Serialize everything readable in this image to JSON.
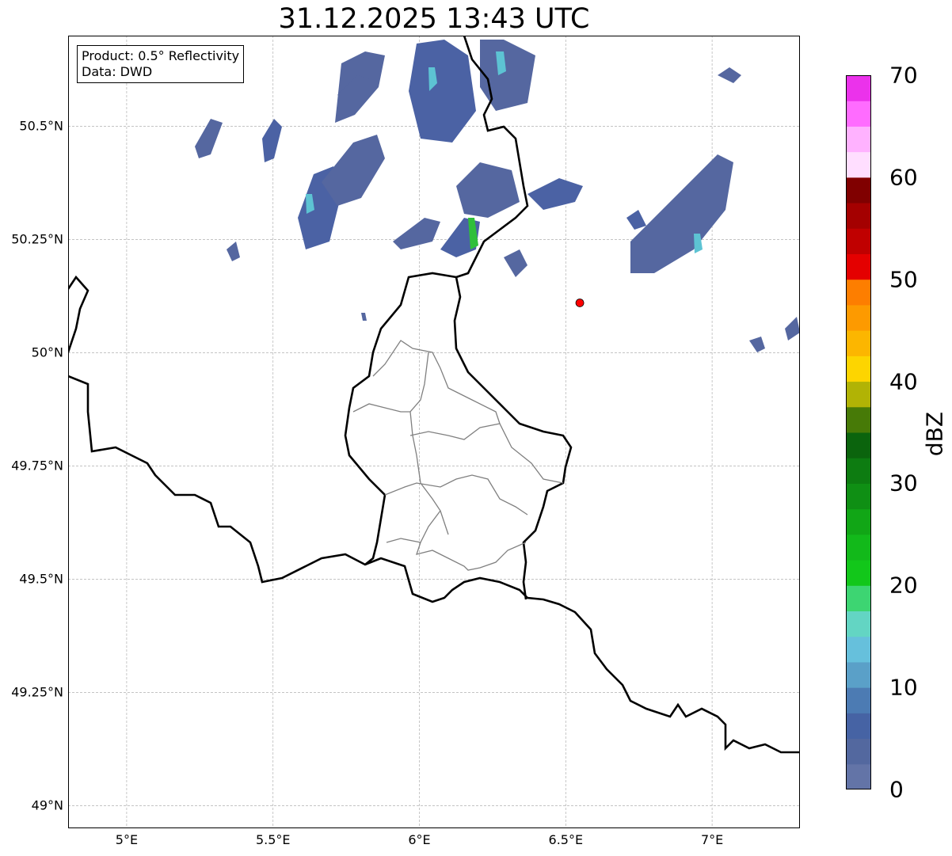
{
  "title": "31.12.2025 13:43 UTC",
  "info": {
    "product": "Product: 0.5° Reflectivity",
    "data_source": "Data: DWD"
  },
  "axes": {
    "lat_ticks": [
      "50.5°N",
      "50.25°N",
      "50°N",
      "49.75°N",
      "49.5°N",
      "49.25°N",
      "49°N"
    ],
    "lat_values": [
      50.5,
      50.25,
      50.0,
      49.75,
      49.5,
      49.25,
      49.0
    ],
    "lon_ticks": [
      "5°E",
      "5.5°E",
      "6°E",
      "6.5°E",
      "7°E"
    ],
    "lon_values": [
      5.0,
      5.5,
      6.0,
      6.5,
      7.0
    ],
    "lon_range": [
      4.8,
      7.3
    ],
    "lat_range": [
      48.95,
      50.7
    ],
    "grid": true
  },
  "radar_site": {
    "lon": 6.548,
    "lat": 50.11,
    "color": "#ff0000"
  },
  "colorbar": {
    "label": "dBZ",
    "ticks": [
      "0",
      "10",
      "20",
      "30",
      "40",
      "50",
      "60",
      "70"
    ],
    "range": [
      0,
      70
    ],
    "colors": [
      "#6374a7",
      "#53689f",
      "#4663a4",
      "#4c7bb3",
      "#5aa0c8",
      "#66c0dc",
      "#63d5c3",
      "#3dd572",
      "#12c71a",
      "#12b91a",
      "#11a616",
      "#0f8f14",
      "#0d7c11",
      "#0b640d",
      "#477a07",
      "#b1b305",
      "#fdd500",
      "#fcb600",
      "#fd9a00",
      "#fd7e00",
      "#e40000",
      "#c00000",
      "#a40000",
      "#800000",
      "#ffdeff",
      "#ffb2ff",
      "#ff6cff",
      "#eb32eb"
    ]
  },
  "colors": {
    "border": "#000000",
    "cantons": "#808080",
    "grid": "#b0b0b0"
  }
}
